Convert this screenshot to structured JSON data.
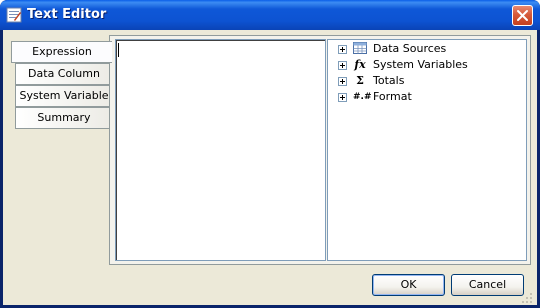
{
  "window": {
    "title": "Text Editor"
  },
  "tabs": [
    {
      "label": "Expression",
      "active": true
    },
    {
      "label": "Data Column",
      "active": false
    },
    {
      "label": "System Variable",
      "active": false
    },
    {
      "label": "Summary",
      "active": false
    }
  ],
  "editor": {
    "value": ""
  },
  "tree": {
    "items": [
      {
        "label": "Data Sources",
        "icon": "table-icon"
      },
      {
        "label": "System Variables",
        "icon": "fx-icon",
        "glyph": "fx"
      },
      {
        "label": "Totals",
        "icon": "sigma-icon",
        "glyph": "Σ"
      },
      {
        "label": "Format",
        "icon": "format-icon",
        "glyph": "#.#"
      }
    ]
  },
  "buttons": {
    "ok": "OK",
    "cancel": "Cancel"
  },
  "colors": {
    "titlebar": "#0d53d2",
    "close": "#d65a3a",
    "client": "#ece9d8"
  }
}
